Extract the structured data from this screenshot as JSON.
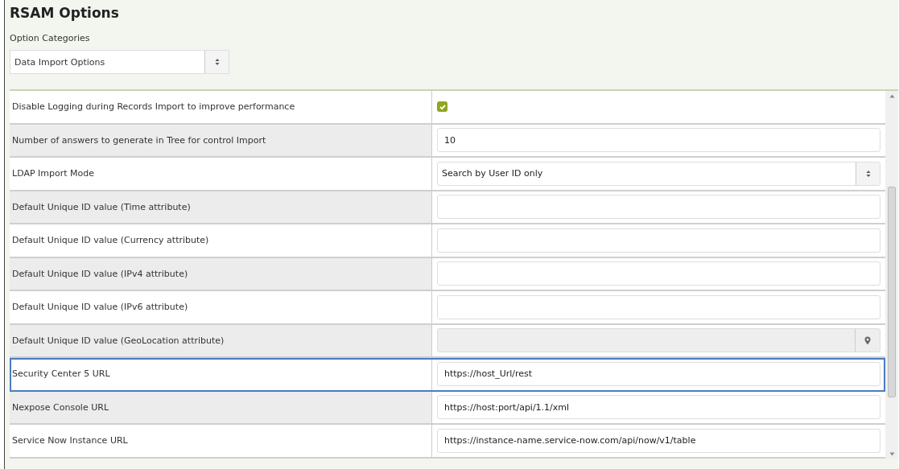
{
  "title": "RSAM Options",
  "category": {
    "label": "Option Categories",
    "value": "Data Import Options"
  },
  "rows": [
    {
      "label": "Disable Logging during Records Import to improve performance",
      "kind": "checkbox",
      "checked": true,
      "focused": false
    },
    {
      "label": "Number of answers to generate in Tree for control Import",
      "kind": "text",
      "value": "10",
      "focused": false
    },
    {
      "label": "LDAP Import Mode",
      "kind": "select",
      "value": "Search by User ID only",
      "focused": false
    },
    {
      "label": "Default Unique ID value (Time attribute)",
      "kind": "text",
      "focused": false
    },
    {
      "label": "Default Unique ID value (Currency attribute)",
      "kind": "text",
      "focused": false
    },
    {
      "label": "Default Unique ID value (IPv4 attribute)",
      "kind": "text",
      "focused": false
    },
    {
      "label": "Default Unique ID value (IPv6 attribute)",
      "kind": "text",
      "focused": false
    },
    {
      "label": "Default Unique ID value (GeoLocation attribute)",
      "kind": "geo",
      "disabled": true,
      "focused": false
    },
    {
      "label": "Security Center 5 URL",
      "kind": "text",
      "value": "https://host_Url/rest",
      "focused": true
    },
    {
      "label": "Nexpose Console URL",
      "kind": "text",
      "value": "https://host:port/api/1.1/xml",
      "focused": false
    },
    {
      "label": "Service Now Instance URL",
      "kind": "text",
      "value": "https://instance-name.service-now.com/api/now/v1/table",
      "focused": false
    }
  ]
}
